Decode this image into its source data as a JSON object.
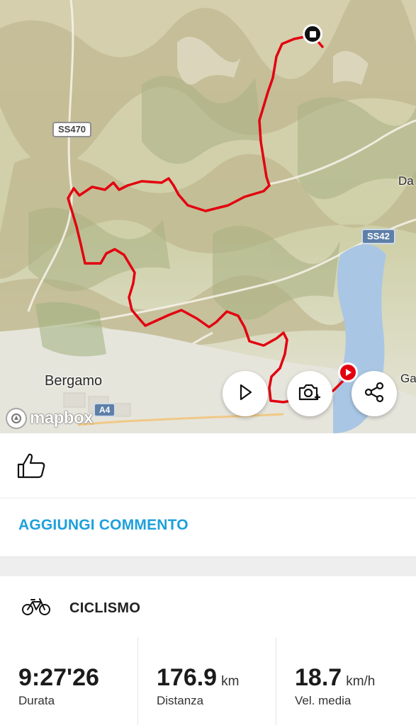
{
  "map": {
    "road_labels": [
      "SS470",
      "SS42",
      "A4"
    ],
    "place_labels": [
      "Bergamo",
      "Da",
      "Ga"
    ],
    "attribution": "mapbox",
    "route_color": "#e3000f",
    "buttons": {
      "play_icon": "play-icon",
      "camera_icon": "camera-add-icon",
      "share_icon": "share-icon"
    }
  },
  "social": {
    "like_icon": "thumbs-up-icon",
    "comment_label": "AGGIUNGI COMMENTO"
  },
  "activity": {
    "icon": "bicycle-icon",
    "type": "CICLISMO",
    "stats": [
      {
        "value": "9:27'26",
        "unit": "",
        "label": "Durata"
      },
      {
        "value": "176.9",
        "unit": "km",
        "label": "Distanza"
      },
      {
        "value": "18.7",
        "unit": "km/h",
        "label": "Vel. media"
      }
    ]
  },
  "colors": {
    "accent": "#1ea0dc",
    "route": "#e3000f",
    "text": "#1b1b1b"
  }
}
